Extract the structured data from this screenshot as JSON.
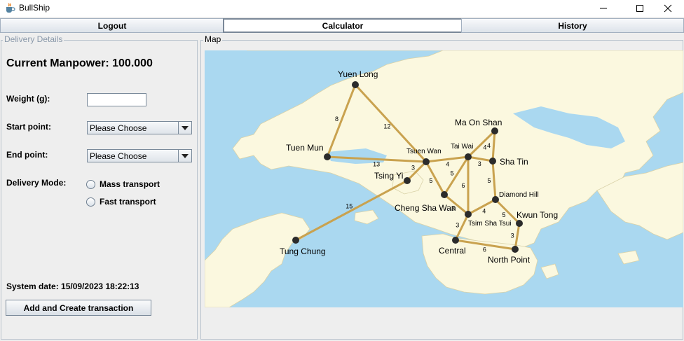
{
  "window": {
    "title": "BullShip"
  },
  "tabs": [
    {
      "label": "Logout"
    },
    {
      "label": "Calculator"
    },
    {
      "label": "History"
    }
  ],
  "delivery": {
    "group_title": "Delivery Details",
    "manpower_label": "Current Manpower: 100.000",
    "weight_label": "Weight (g):",
    "weight_value": "",
    "start_label": "Start point:",
    "start_value": "Please Choose",
    "end_label": "End point:",
    "end_value": "Please Choose",
    "mode_label": "Delivery Mode:",
    "modes": [
      {
        "label": "Mass transport"
      },
      {
        "label": "Fast transport"
      }
    ],
    "system_date_label": "System date:",
    "system_date_value": "15/09/2023 18:22:13",
    "add_button": "Add and Create transaction"
  },
  "map": {
    "group_title": "Map",
    "stations": [
      {
        "name": "Yuen Long"
      },
      {
        "name": "Tuen Mun"
      },
      {
        "name": "Tsuen Wan"
      },
      {
        "name": "Tsing Yi"
      },
      {
        "name": "Tai Wai"
      },
      {
        "name": "Ma On Shan"
      },
      {
        "name": "Sha Tin"
      },
      {
        "name": "Cheng Sha Wan"
      },
      {
        "name": "Diamond Hill"
      },
      {
        "name": "Tsim Sha Tsui"
      },
      {
        "name": "Kwun Tong"
      },
      {
        "name": "Tung Chung"
      },
      {
        "name": "Central"
      },
      {
        "name": "North Point"
      }
    ],
    "routes": [
      {
        "from": "Yuen Long",
        "to": "Tuen Mun",
        "distance": "8"
      },
      {
        "from": "Yuen Long",
        "to": "Tsuen Wan",
        "distance": "12"
      },
      {
        "from": "Tuen Mun",
        "to": "Tsuen Wan",
        "distance": "13"
      },
      {
        "from": "Tsuen Wan",
        "to": "Tai Wai",
        "distance": "4"
      },
      {
        "from": "Tsuen Wan",
        "to": "Tsing Yi",
        "distance": "3"
      },
      {
        "from": "Tsuen Wan",
        "to": "Cheng Sha Wan",
        "distance": "5"
      },
      {
        "from": "Tai Wai",
        "to": "Ma On Shan",
        "distance": "4"
      },
      {
        "from": "Tai Wai",
        "to": "Sha Tin",
        "distance": "3"
      },
      {
        "from": "Ma On Shan",
        "to": "Sha Tin",
        "distance": "4"
      },
      {
        "from": "Tai Wai",
        "to": "Cheng Sha Wan",
        "distance": "5"
      },
      {
        "from": "Tai Wai",
        "to": "Tsim Sha Tsui",
        "distance": "6"
      },
      {
        "from": "Sha Tin",
        "to": "Diamond Hill",
        "distance": "5"
      },
      {
        "from": "Cheng Sha Wan",
        "to": "Tsim Sha Tsui",
        "distance": "3"
      },
      {
        "from": "Tsim Sha Tsui",
        "to": "Diamond Hill",
        "distance": "4"
      },
      {
        "from": "Diamond Hill",
        "to": "Kwun Tong",
        "distance": "5"
      },
      {
        "from": "Tsim Sha Tsui",
        "to": "Central",
        "distance": "3"
      },
      {
        "from": "Kwun Tong",
        "to": "North Point",
        "distance": "3"
      },
      {
        "from": "Central",
        "to": "North Point",
        "distance": "6"
      },
      {
        "from": "Tsing Yi",
        "to": "Tung Chung",
        "distance": "15"
      }
    ]
  },
  "colors": {
    "water": "#aad8f0",
    "land": "#fbf8df",
    "route": "#c9a24f",
    "node": "#2b2b2b"
  }
}
